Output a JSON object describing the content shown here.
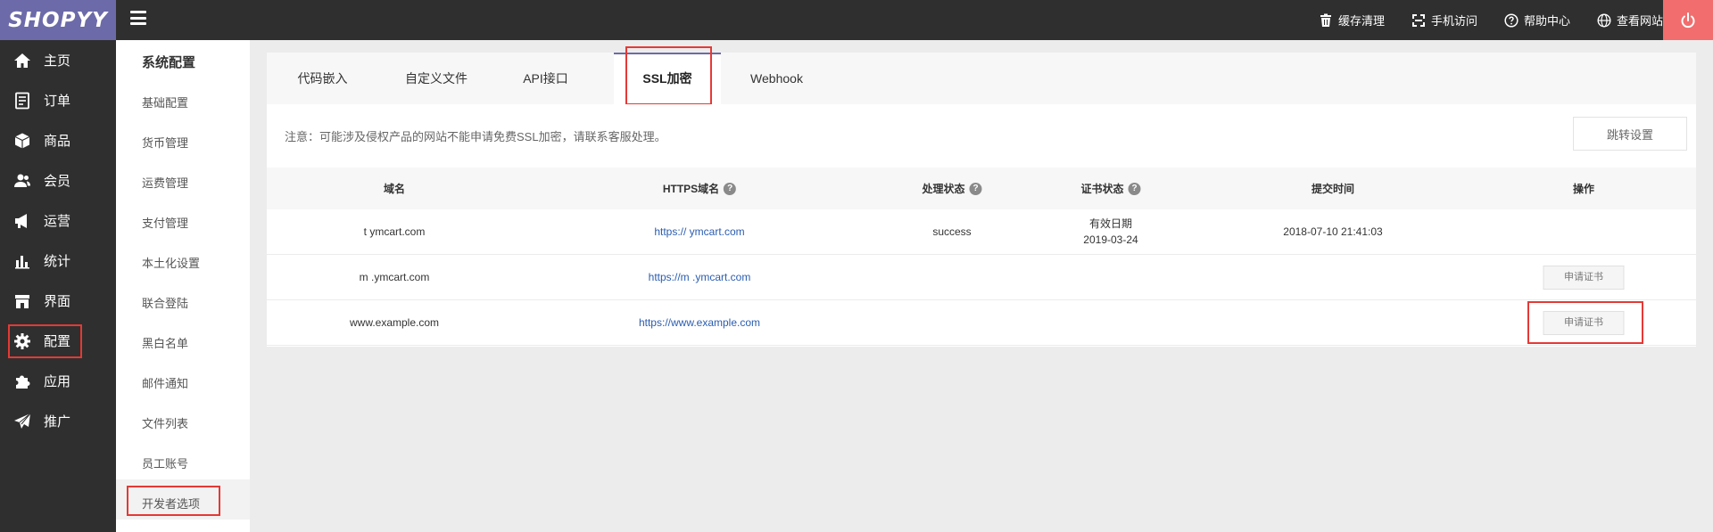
{
  "app": {
    "logo": "SHOPYY",
    "accent": "#6c6aa8",
    "highlight_color": "#e53935"
  },
  "topbar": {
    "actions": [
      {
        "icon": "trash-icon",
        "label": "缓存清理"
      },
      {
        "icon": "qrcode-icon",
        "label": "手机访问"
      },
      {
        "icon": "help-circle-icon",
        "label": "帮助中心"
      },
      {
        "icon": "globe-icon",
        "label": "查看网站"
      }
    ],
    "power_icon": "power-icon"
  },
  "leftnav": {
    "items": [
      {
        "icon": "home-icon",
        "label": "主页"
      },
      {
        "icon": "order-icon",
        "label": "订单"
      },
      {
        "icon": "box-icon",
        "label": "商品"
      },
      {
        "icon": "users-icon",
        "label": "会员"
      },
      {
        "icon": "megaphone-icon",
        "label": "运营"
      },
      {
        "icon": "bar-chart-icon",
        "label": "统计"
      },
      {
        "icon": "store-icon",
        "label": "界面"
      },
      {
        "icon": "gear-icon",
        "label": "配置"
      },
      {
        "icon": "puzzle-icon",
        "label": "应用"
      },
      {
        "icon": "send-icon",
        "label": "推广"
      }
    ],
    "selected": "配置"
  },
  "subnav": {
    "title": "系统配置",
    "items": [
      "基础配置",
      "货币管理",
      "运费管理",
      "支付管理",
      "本土化设置",
      "联合登陆",
      "黑白名单",
      "邮件通知",
      "文件列表",
      "员工账号",
      "开发者选项"
    ],
    "selected": "开发者选项"
  },
  "tabs": {
    "items": [
      "代码嵌入",
      "自定义文件",
      "API接口",
      "SSL加密",
      "Webhook"
    ],
    "active": "SSL加密"
  },
  "panel": {
    "notice": "注意：可能涉及侵权产品的网站不能申请免费SSL加密，请联系客服处理。",
    "jump_button": "跳转设置",
    "columns": [
      "域名",
      "HTTPS域名",
      "处理状态",
      "证书状态",
      "提交时间",
      "操作"
    ],
    "help_icon": "?",
    "rows": [
      {
        "domain": "t    ymcart.com",
        "https": "https://    ymcart.com",
        "status": "success",
        "cert_label": "有效日期",
        "cert_date": "2019-03-24",
        "time": "2018-07-10 21:41:03",
        "action": ""
      },
      {
        "domain": "m    .ymcart.com",
        "https": "https://m    .ymcart.com",
        "status": "",
        "cert_label": "",
        "cert_date": "",
        "time": "",
        "action": "申请证书"
      },
      {
        "domain": "www.example.com",
        "https": "https://www.example.com",
        "status": "",
        "cert_label": "",
        "cert_date": "",
        "time": "",
        "action": "申请证书"
      }
    ]
  }
}
